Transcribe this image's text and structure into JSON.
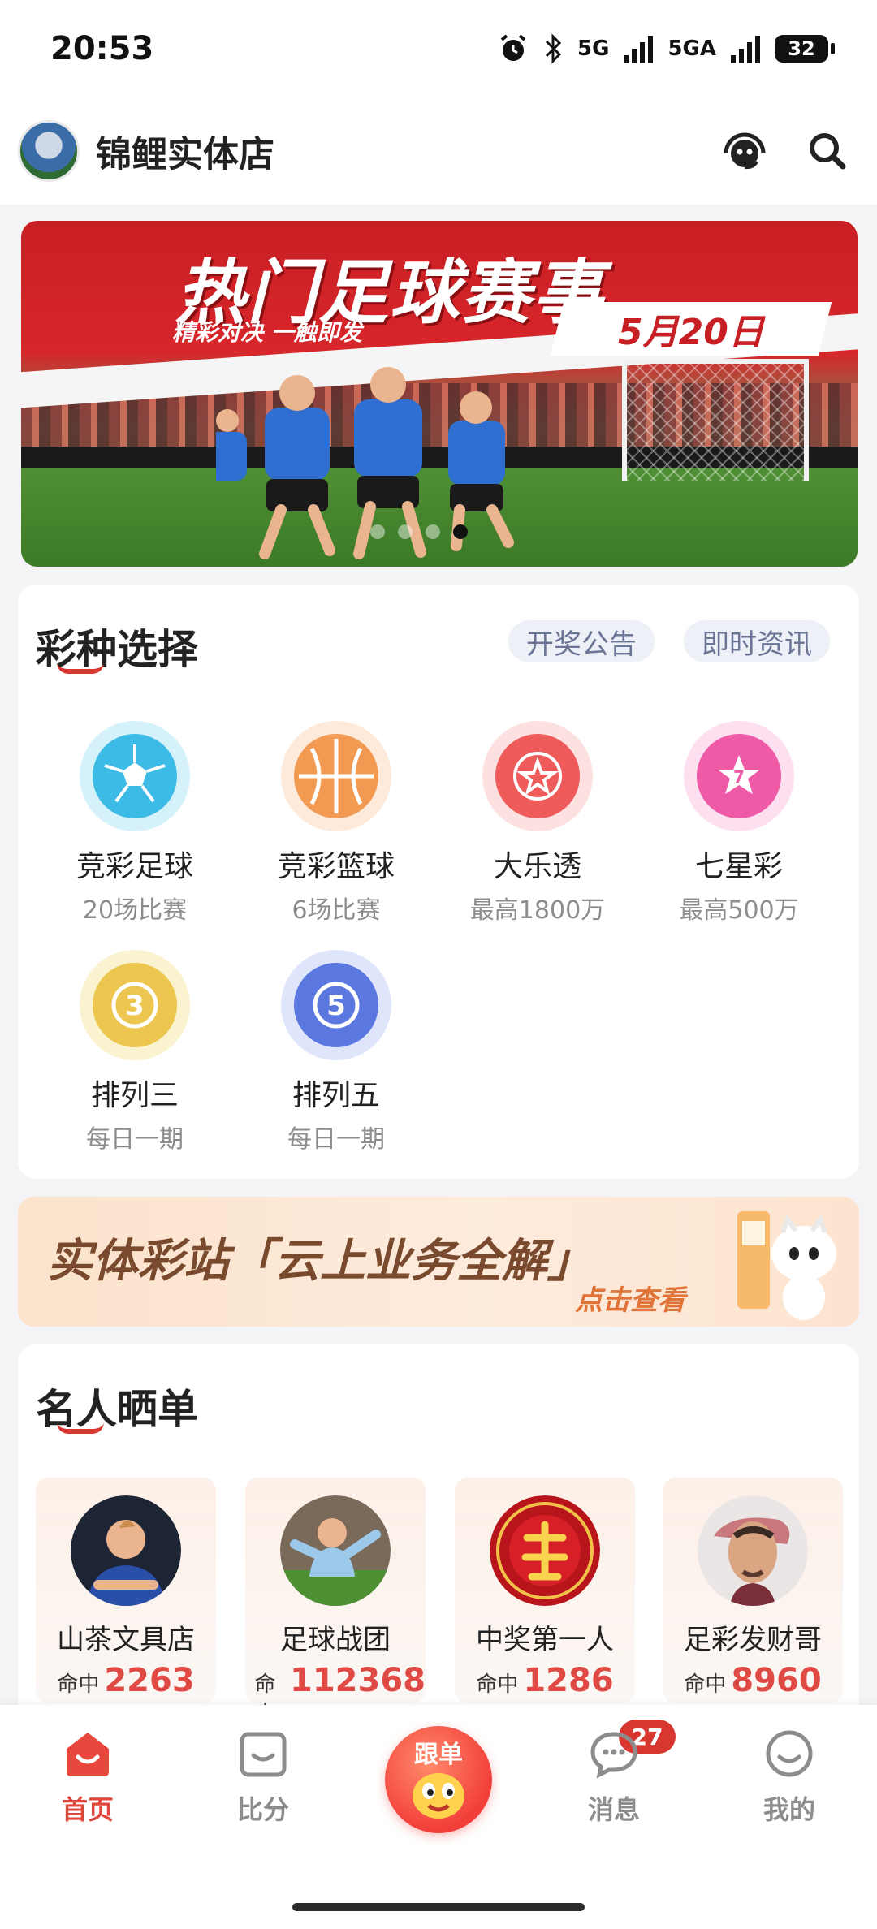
{
  "status_bar": {
    "time": "20:53",
    "net1": "5G",
    "net2": "5GA",
    "battery": "32"
  },
  "header": {
    "shop_name": "锦鲤实体店",
    "icons": [
      "customer-service-icon",
      "search-icon"
    ]
  },
  "banner": {
    "title": "热门足球赛事",
    "subtitle": "精彩对决 一触即发",
    "date": "5月20日"
  },
  "lottery_section": {
    "title": "彩种选择",
    "links": [
      "开奖公告",
      "即时资讯"
    ],
    "items": [
      {
        "name": "竞彩足球",
        "sub": "20场比赛",
        "icon": "football-icon",
        "color": "#3bbbe6"
      },
      {
        "name": "竞彩篮球",
        "sub": "6场比赛",
        "icon": "basketball-icon",
        "color": "#f39a52"
      },
      {
        "name": "大乐透",
        "sub": "最高1800万",
        "icon": "star-ball-icon",
        "color": "#ef5a5a"
      },
      {
        "name": "七星彩",
        "sub": "最高500万",
        "icon": "seven-star-icon",
        "color": "#ee5aa6"
      },
      {
        "name": "排列三",
        "sub": "每日一期",
        "icon": "number-3-ball-icon",
        "color": "#ecc64e",
        "digit": "3"
      },
      {
        "name": "排列五",
        "sub": "每日一期",
        "icon": "number-5-ball-icon",
        "color": "#5b78e0",
        "digit": "5"
      }
    ]
  },
  "promo": {
    "title": "实体彩站「云上业务全解」",
    "link": "点击查看"
  },
  "celebrity_section": {
    "title": "名人晒单",
    "hit_label": "命中",
    "items": [
      {
        "name": "山茶文具店",
        "hits": "2263"
      },
      {
        "name": "足球战团",
        "hits": "112368"
      },
      {
        "name": "中奖第一人",
        "hits": "1286"
      },
      {
        "name": "足彩发财哥",
        "hits": "8960"
      }
    ]
  },
  "bottom_nav": {
    "items": [
      {
        "label": "首页",
        "icon": "home-icon",
        "active": true
      },
      {
        "label": "比分",
        "icon": "score-icon",
        "active": false
      },
      {
        "label": "跟单",
        "icon": "follow-bet-icon",
        "active": false
      },
      {
        "label": "消息",
        "icon": "message-icon",
        "active": false
      },
      {
        "label": "我的",
        "icon": "profile-icon",
        "active": false
      }
    ],
    "message_badge": "27"
  },
  "colors": {
    "accent": "#e0463c",
    "muted": "#8c8c8c"
  }
}
